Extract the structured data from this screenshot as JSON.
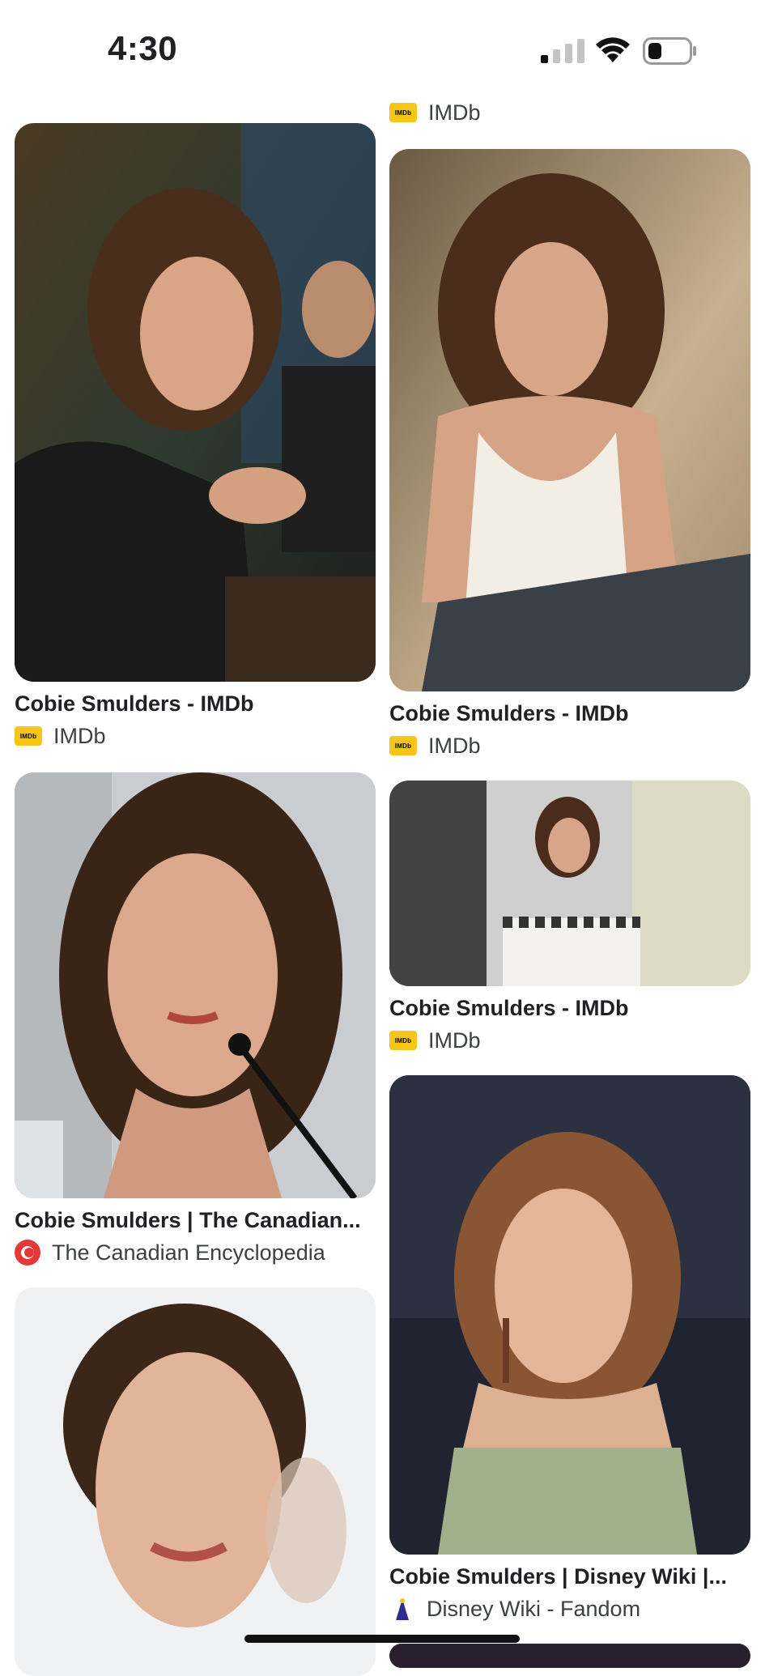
{
  "status_bar": {
    "time": "4:30"
  },
  "results": {
    "left": [
      {
        "title": "Cobie Smulders - IMDb",
        "source": "IMDb",
        "source_icon": "imdb-icon",
        "imdb_label": "IMDb"
      },
      {
        "title": "Cobie Smulders | The Canadian...",
        "source": "The Canadian Encyclopedia",
        "source_icon": "canadian-encyclopedia-icon"
      },
      {
        "title": "",
        "source": ""
      }
    ],
    "right": [
      {
        "title": "",
        "source": "IMDb",
        "source_icon": "imdb-icon",
        "imdb_label": "IMDb"
      },
      {
        "title": "Cobie Smulders - IMDb",
        "source": "IMDb",
        "source_icon": "imdb-icon",
        "imdb_label": "IMDb"
      },
      {
        "title": "Cobie Smulders - IMDb",
        "source": "IMDb",
        "source_icon": "imdb-icon",
        "imdb_label": "IMDb"
      },
      {
        "title": "Cobie Smulders | Disney Wiki |...",
        "source": "Disney Wiki - Fandom",
        "source_icon": "disney-wiki-icon"
      }
    ]
  },
  "colors": {
    "imdb_yellow": "#f5c518",
    "text": "#202124",
    "ce_red": "#e53935",
    "disney_blue": "#2b2f8f"
  }
}
